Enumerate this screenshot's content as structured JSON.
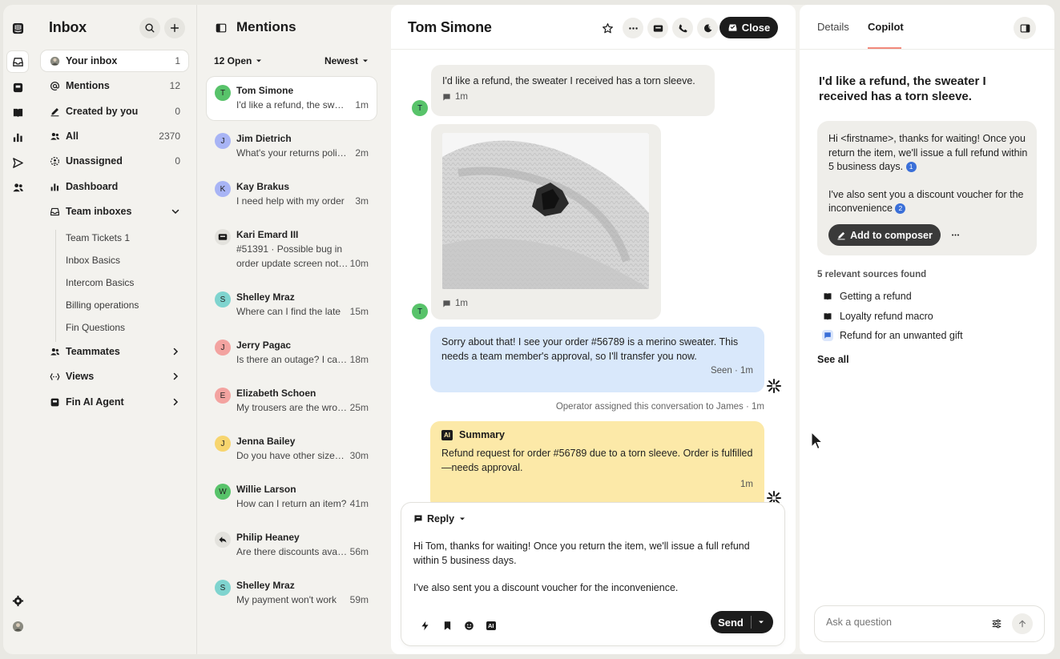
{
  "nav": {
    "title": "Inbox",
    "items": [
      {
        "label": "Your inbox",
        "count": "1"
      },
      {
        "label": "Mentions",
        "count": "12"
      },
      {
        "label": "Created by you",
        "count": "0"
      },
      {
        "label": "All",
        "count": "2370"
      },
      {
        "label": "Unassigned",
        "count": "0"
      },
      {
        "label": "Dashboard",
        "count": ""
      },
      {
        "label": "Team inboxes",
        "count": ""
      }
    ],
    "team_inboxes": [
      "Team Tickets 1",
      "Inbox Basics",
      "Intercom Basics",
      "Billing operations",
      "Fin Questions"
    ],
    "sections": [
      {
        "label": "Teammates"
      },
      {
        "label": "Views"
      },
      {
        "label": "Fin AI Agent"
      }
    ]
  },
  "list": {
    "title": "Mentions",
    "filter_open": "12 Open",
    "sort": "Newest",
    "conversations": [
      {
        "initial": "T",
        "color": "#58c36a",
        "name": "Tom Simone",
        "preview": "I'd like a refund, the sweater has a torn sleeve.",
        "time": "1m"
      },
      {
        "initial": "J",
        "color": "#a8b4f5",
        "name": "Jim Dietrich",
        "preview": "What's your returns policy for sale items?",
        "time": "2m"
      },
      {
        "initial": "K",
        "color": "#a8b4f5",
        "name": "Kay Brakus",
        "preview": "I need help with my order",
        "time": "3m"
      },
      {
        "initial": "",
        "color": "#e3e2dd",
        "name": "Kari Emard III",
        "preview": "#51391 · Possible bug in",
        "preview2": "order update screen not loading",
        "time": "10m"
      },
      {
        "initial": "S",
        "color": "#7fd4cf",
        "name": "Shelley Mraz",
        "preview": "Where can I find the late",
        "time": "15m"
      },
      {
        "initial": "J",
        "color": "#f3a3a0",
        "name": "Jerry Pagac",
        "preview": "Is there an outage? I can't log in",
        "time": "18m"
      },
      {
        "initial": "E",
        "color": "#f3a3a0",
        "name": "Elizabeth Schoen",
        "preview": "My trousers are the wrong size",
        "time": "25m"
      },
      {
        "initial": "J",
        "color": "#f7d56e",
        "name": "Jenna Bailey",
        "preview": "Do you have other sizes in stock?",
        "time": "30m"
      },
      {
        "initial": "W",
        "color": "#58c36a",
        "name": "Willie Larson",
        "preview": "How can I return an item?",
        "time": "41m"
      },
      {
        "initial": "",
        "color": "#e3e2dd",
        "name": "Philip Heaney",
        "preview": "Are there discounts available?",
        "time": "56m"
      },
      {
        "initial": "S",
        "color": "#7fd4cf",
        "name": "Shelley Mraz",
        "preview": "My payment won't work",
        "time": "59m"
      }
    ]
  },
  "conversation": {
    "name": "Tom Simone",
    "close_label": "Close",
    "msg1": {
      "text": "I'd like a refund, the sweater I received has a torn sleeve.",
      "time": "1m",
      "avatar": "T"
    },
    "msg2": {
      "time": "1m",
      "avatar": "T"
    },
    "msg3": {
      "text": "Sorry about that! I see your order #56789 is a merino sweater. This needs a team member's approval, so I'll transfer you now.",
      "meta": "Seen · 1m"
    },
    "event": "Operator assigned this conversation to James · 1m",
    "summary": {
      "badge": "AI",
      "title": "Summary",
      "text": "Refund request for order #56789 due to a torn sleeve. Order is fulfilled—needs approval.",
      "time": "1m"
    },
    "composer": {
      "mode": "Reply",
      "line1": "Hi Tom, thanks for waiting! Once you return the item, we'll issue a full refund within 5 business days.",
      "line2": "I've also sent you a discount voucher for the inconvenience.",
      "send_label": "Send",
      "ai_badge": "AI"
    }
  },
  "copilot": {
    "tabs": [
      "Details",
      "Copilot"
    ],
    "question": "I'd like a refund, the sweater I received has a torn sleeve.",
    "answer_p1": "Hi <firstname>, thanks for waiting! Once you return the item, we'll issue a full refund within 5 business days.",
    "ref1": "1",
    "answer_p2": "I've also sent you a discount voucher for the inconvenience",
    "ref2": "2",
    "add_label": "Add to composer",
    "sources_title": "5 relevant sources found",
    "sources": [
      "Getting a refund",
      "Loyalty refund macro",
      "Refund for an unwanted gift"
    ],
    "see_all": "See all",
    "ask_placeholder": "Ask a question"
  }
}
